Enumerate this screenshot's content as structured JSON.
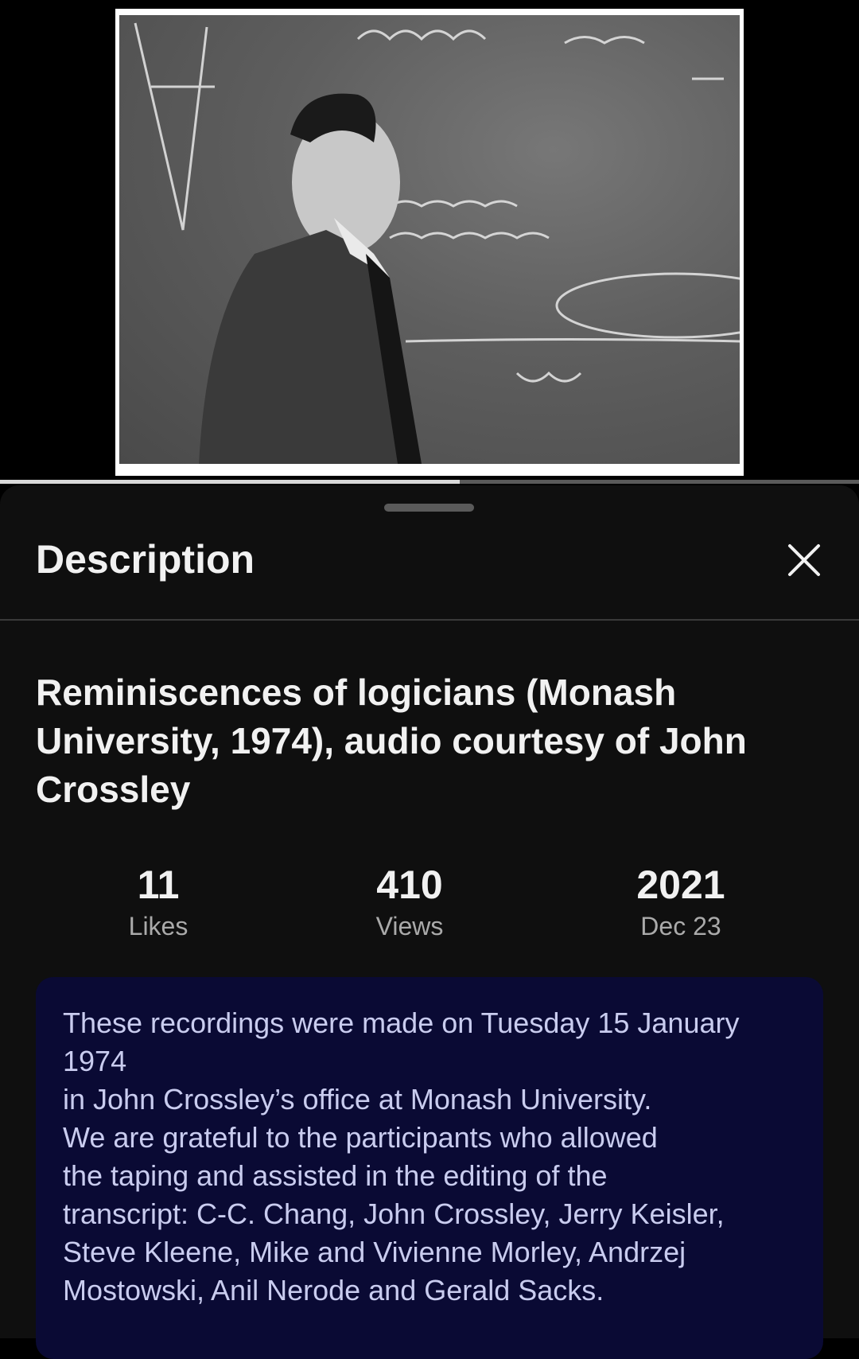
{
  "player": {
    "progress_fraction": 0.535
  },
  "sheet": {
    "title": "Description",
    "close_icon": "close-icon"
  },
  "video": {
    "title": "Reminiscences of logicians (Monash University, 1974), audio courtesy of John Crossley"
  },
  "stats": {
    "likes_value": "11",
    "likes_label": "Likes",
    "views_value": "410",
    "views_label": "Views",
    "year_value": "2021",
    "date_label": "Dec 23"
  },
  "description": {
    "text": "These recordings were made on Tuesday 15 January 1974\nin John Crossley’s office at Monash University.\nWe are grateful to the participants who allowed\nthe taping and assisted in the editing of the\ntranscript: C-C. Chang, John Crossley, Jerry Keisler,\nSteve Kleene, Mike and Vivienne Morley, Andrzej\nMostowski, Anil Nerode and Gerald Sacks."
  },
  "colors": {
    "sheet_background": "#0f0f0f",
    "description_background": "#0a0a34",
    "description_text": "#c9ccef"
  }
}
